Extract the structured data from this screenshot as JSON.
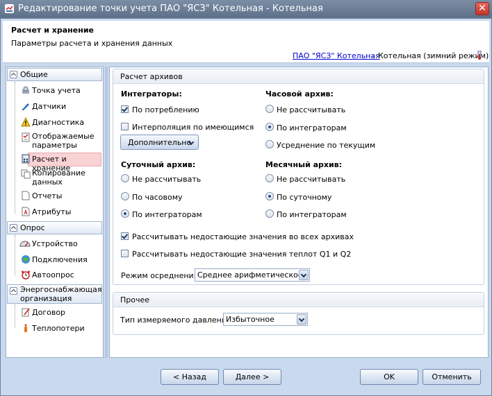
{
  "window": {
    "title": "Редактирование точки учета ПАО \"ЯСЗ\" Котельная - Котельная",
    "close_label": "✕"
  },
  "header": {
    "title": "Расчет и хранение",
    "subtitle": "Параметры расчета и хранения данных",
    "link": "ПАО \"ЯСЗ\" Котельная",
    "separator": "-",
    "mode": "Котельная (зимний режим)"
  },
  "sidebar": {
    "groups": [
      {
        "label": "Общие"
      },
      {
        "label": "Опрос"
      },
      {
        "label": "Энергоснабжающая организация"
      }
    ],
    "items": [
      {
        "label": "Точка учета",
        "icon": "meter-point-icon"
      },
      {
        "label": "Датчики",
        "icon": "sensor-icon"
      },
      {
        "label": "Диагностика",
        "icon": "warning-icon"
      },
      {
        "label": "Отображаемые параметры",
        "icon": "checklist-icon"
      },
      {
        "label": "Расчет и хранение",
        "icon": "calculator-icon"
      },
      {
        "label": "Копирование данных",
        "icon": "copy-icon"
      },
      {
        "label": "Отчеты",
        "icon": "report-icon"
      },
      {
        "label": "Атрибуты",
        "icon": "attributes-icon"
      },
      {
        "label": "Устройство",
        "icon": "gauge-icon"
      },
      {
        "label": "Подключения",
        "icon": "connection-icon"
      },
      {
        "label": "Автоопрос",
        "icon": "alarm-clock-icon"
      },
      {
        "label": "Договор",
        "icon": "contract-icon"
      },
      {
        "label": "Теплопотери",
        "icon": "heat-loss-icon"
      }
    ]
  },
  "archives": {
    "title": "Расчет архивов",
    "integrators": {
      "title": "Интеграторы:",
      "by_consumption": "По потреблению",
      "interpolation": "Интерполяция по имеющимся",
      "more_button": "Дополнительно"
    },
    "hourly": {
      "title": "Часовой архив:",
      "options": [
        "Не рассчитывать",
        "По интеграторам",
        "Усреднение по текущим"
      ],
      "selected": 1
    },
    "daily": {
      "title": "Суточный архив:",
      "options": [
        "Не рассчитывать",
        "По часовому",
        "По интеграторам"
      ],
      "selected": 2
    },
    "monthly": {
      "title": "Месячный архив:",
      "options": [
        "Не рассчитывать",
        "По суточному",
        "По интеграторам"
      ],
      "selected": 1
    },
    "calc_missing_all": "Рассчитывать недостающие значения во всех архивах",
    "calc_missing_q": "Рассчитывать недостающие значения теплот Q1 и Q2",
    "averaging_label": "Режим осреднения:",
    "averaging_value": "Среднее арифметическое"
  },
  "other": {
    "title": "Прочее",
    "pressure_label": "Тип измеряемого давления:",
    "pressure_value": "Избыточное"
  },
  "footer": {
    "back": "< Назад",
    "next": "Далее >",
    "ok": "OK",
    "cancel": "Отменить"
  },
  "colors": {
    "selected_item_bg": "#f9d2d4",
    "title_bar": "#6a7d96",
    "link": "#0000cc"
  }
}
